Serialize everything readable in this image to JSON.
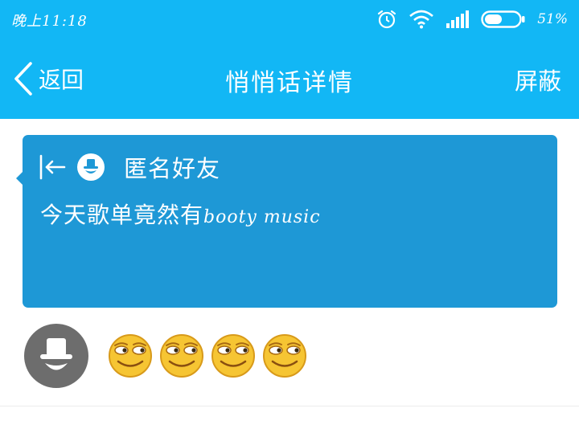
{
  "status_bar": {
    "time": "晚上11:18",
    "battery_percent": "51%",
    "battery_level": 0.51,
    "icons": [
      "alarm-icon",
      "wifi-icon",
      "signal-icon",
      "battery-icon"
    ]
  },
  "nav": {
    "back_label": "返回",
    "title": "悄悄话详情",
    "right_action": "屏蔽"
  },
  "message_card": {
    "sender_name": "匿名好友",
    "text_cjk": "今天歌单竟然有",
    "text_latin": "booty  music"
  },
  "reply": {
    "emoji_count": 4,
    "emoji_name": "smirk-face-icon"
  },
  "colors": {
    "header": "#12b7f5",
    "card": "#1e98d6",
    "avatar": "#6d6d6d",
    "emoji": "#f6c533"
  }
}
